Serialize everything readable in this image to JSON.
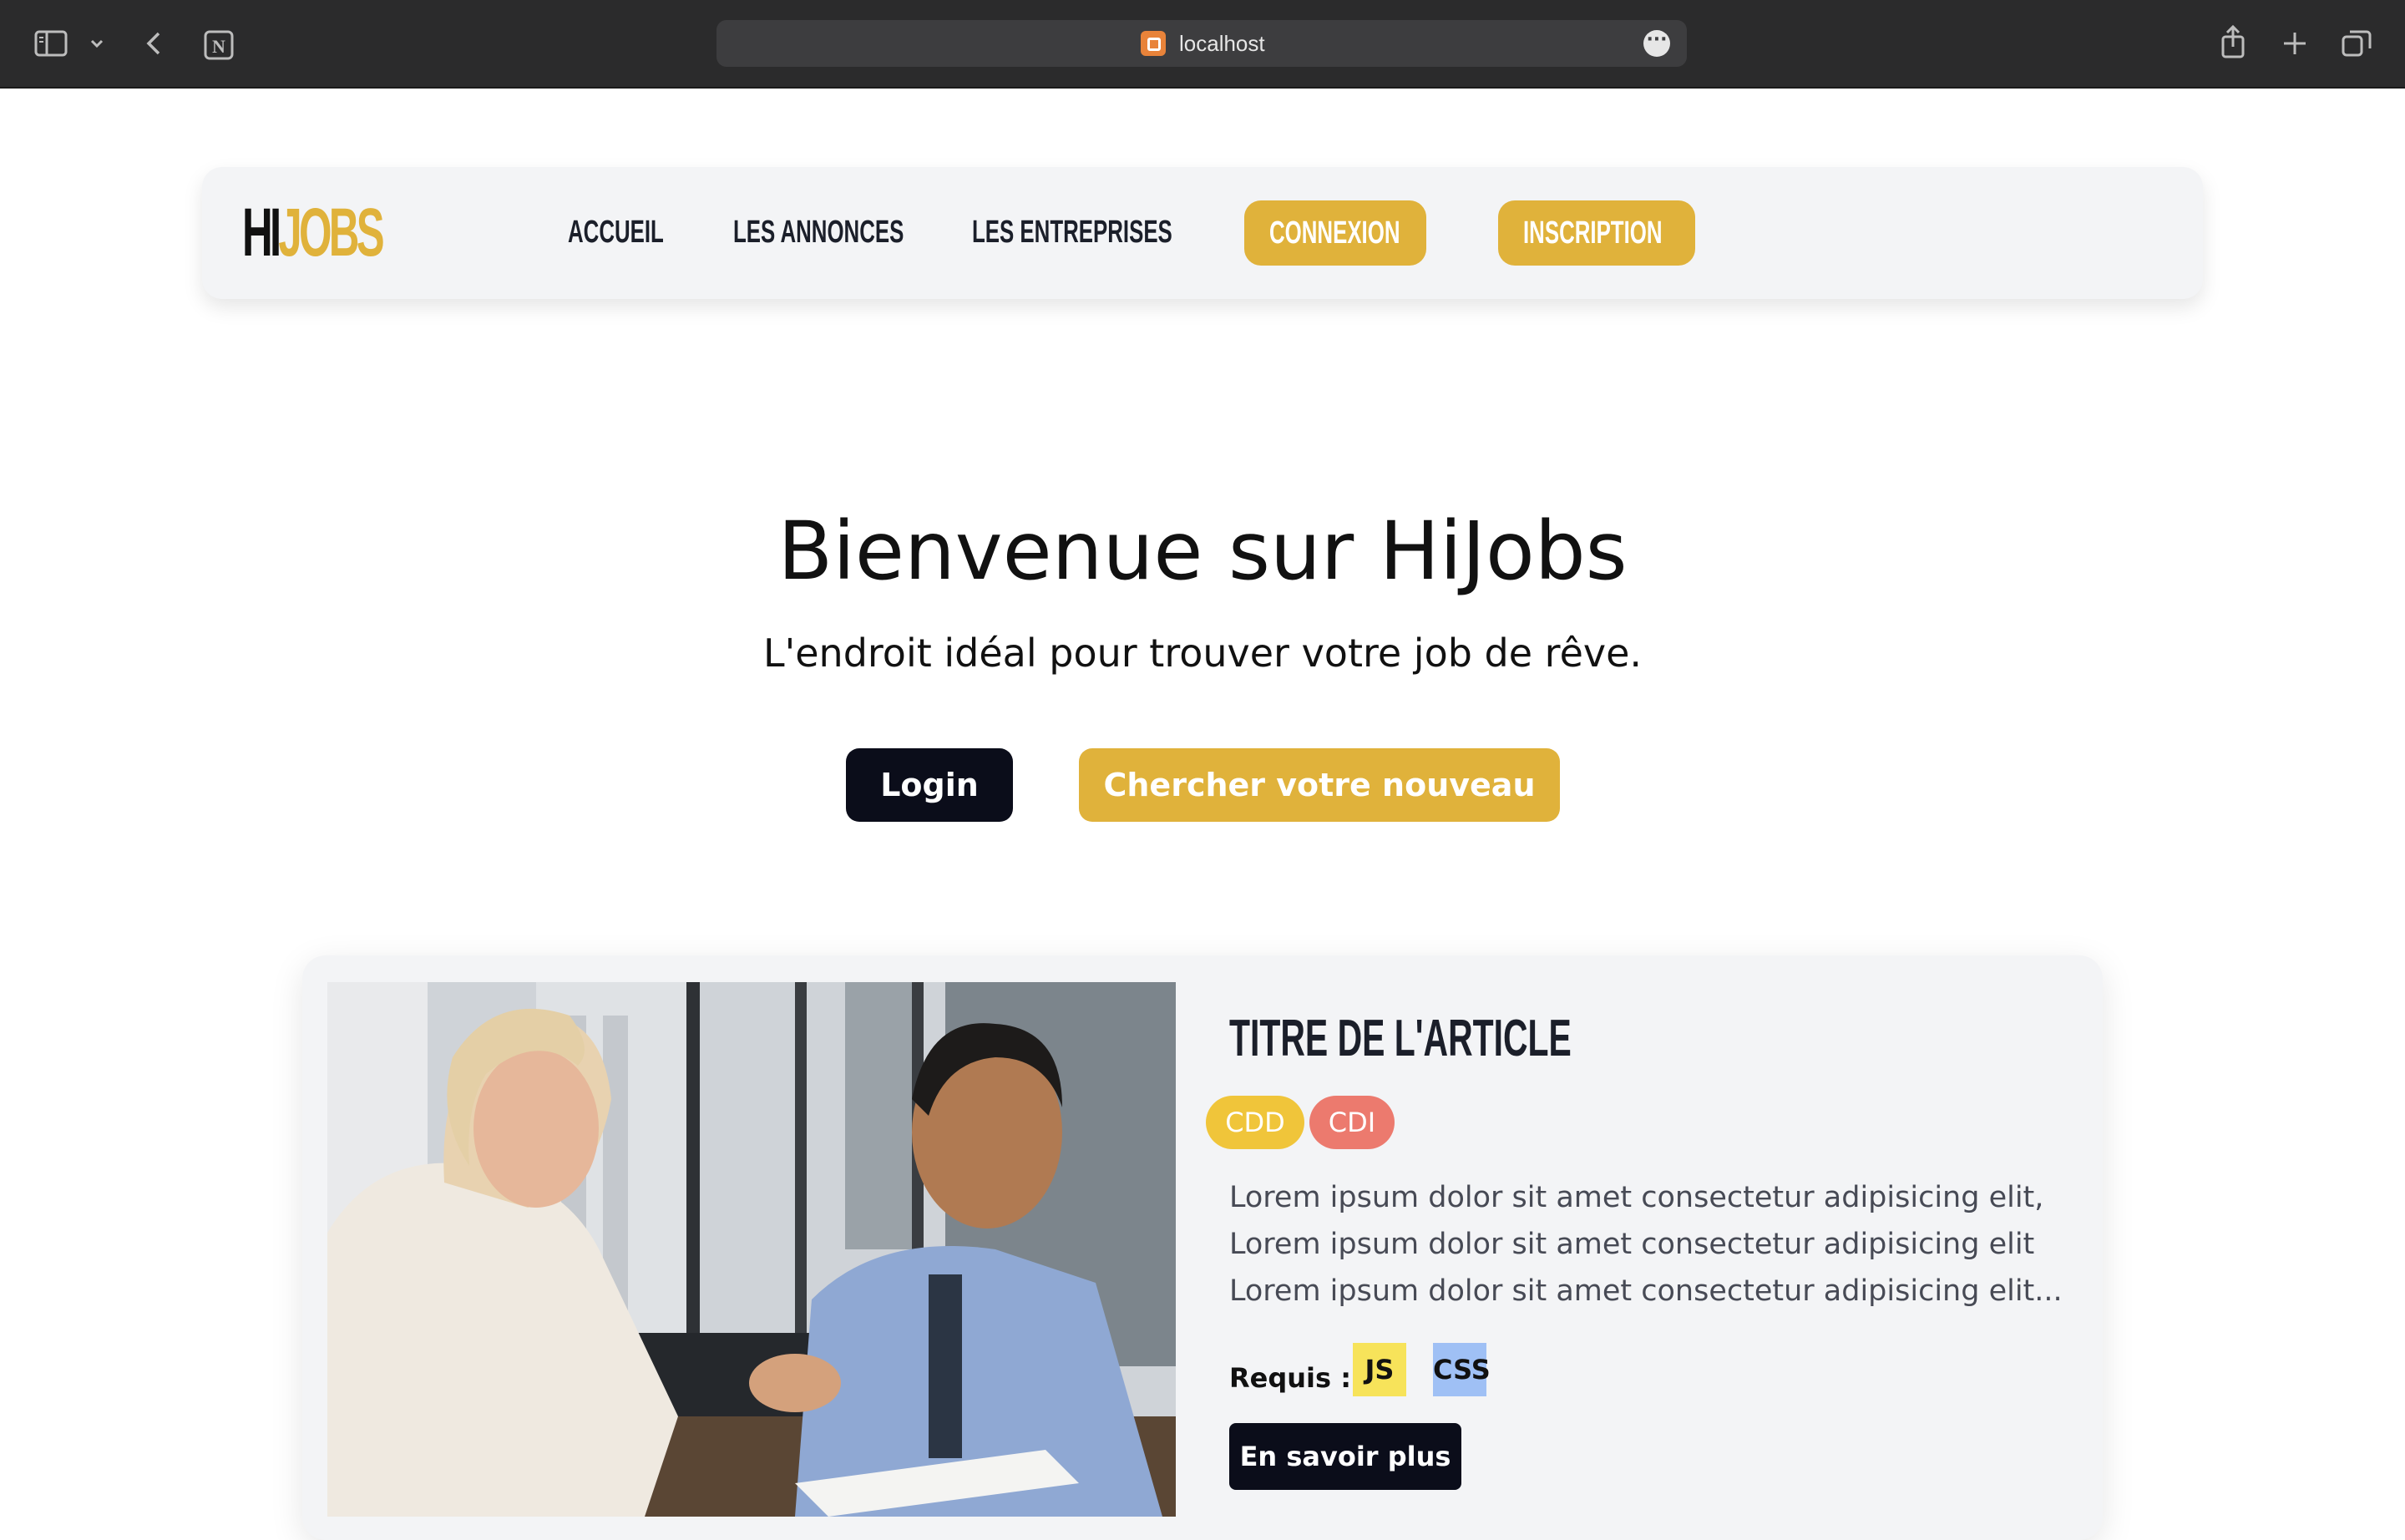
{
  "browser": {
    "url": "localhost"
  },
  "navbar": {
    "logo_part1": "HI",
    "logo_part2": "JOBS",
    "links": [
      "ACCUEIL",
      "LES ANNONCES",
      "LES ENTREPRISES"
    ],
    "connexion": "CONNEXION",
    "inscription": "INSCRIPTION"
  },
  "hero": {
    "title": "Bienvenue sur HiJobs",
    "subtitle": "L'endroit idéal pour trouver votre job de rêve.",
    "login_button": "Login",
    "search_button": "Chercher votre nouveau job"
  },
  "article": {
    "title": "TITRE DE L'ARTICLE",
    "tags": [
      {
        "label": "CDD",
        "color": "#f0c53a"
      },
      {
        "label": "CDI",
        "color": "#ec7a6e"
      }
    ],
    "description": "Lorem ipsum dolor sit amet consectetur adipisicing elit, Lorem ipsum dolor sit amet consectetur adipisicing elit Lorem ipsum dolor sit amet consectetur adipisicing elit...",
    "requirements_label": "Requis :",
    "skills": [
      {
        "label": "JS",
        "color": "#f7e35a"
      },
      {
        "label": "CSS",
        "color": "#9fc0f5"
      }
    ],
    "more_button": "En savoir plus"
  },
  "colors": {
    "accent": "#e0b23b",
    "dark": "#0b0d1a"
  }
}
